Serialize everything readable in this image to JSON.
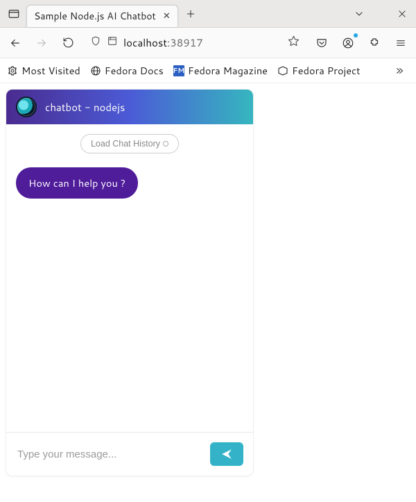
{
  "titlebar": {
    "tab_title": "Sample Node.js AI Chatbot"
  },
  "url": {
    "prefix": "localhost",
    "suffix": ":38917"
  },
  "bookmarks": {
    "most_visited": "Most Visited",
    "fedora_docs": "Fedora Docs",
    "fedora_magazine": "Fedora Magazine",
    "fedora_project": "Fedora Project"
  },
  "chat": {
    "header_title": "chatbot - nodejs",
    "load_history": "Load Chat History",
    "bot_greeting": "How can I help you ?",
    "input_placeholder": "Type your message..."
  }
}
